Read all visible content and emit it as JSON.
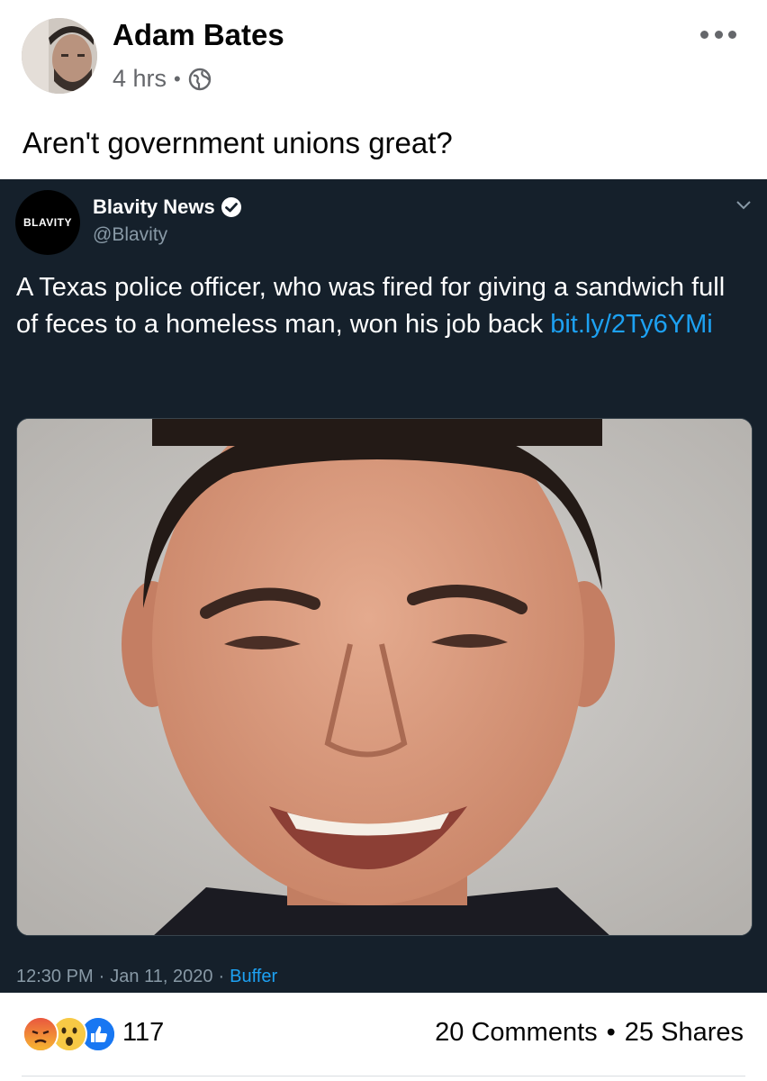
{
  "post": {
    "author": "Adam Bates",
    "time": "4 hrs",
    "meta_separator": "•",
    "privacy_icon": "globe-icon",
    "more_icon": "more-options-icon",
    "text": "Aren't government unions great?"
  },
  "tweet": {
    "account_name": "Blavity News",
    "handle": "@Blavity",
    "avatar_text": "BLAVITY",
    "verified_icon": "verified-badge-icon",
    "text_main": "A Texas police officer, who was fired for giving a sandwich full of feces to a homeless man, won his job back ",
    "link": "bit.ly/2Ty6YMi",
    "time": "12:30 PM",
    "date": "Jan 11, 2020",
    "separator": "·",
    "source": "Buffer",
    "colors": {
      "background": "#15202b",
      "link": "#1da1f2",
      "secondary": "#8899a6"
    }
  },
  "reactions": {
    "icons": [
      "angry-icon",
      "wow-icon",
      "like-icon"
    ],
    "count": "117",
    "comments": "20 Comments",
    "separator": "•",
    "shares": "25 Shares"
  }
}
